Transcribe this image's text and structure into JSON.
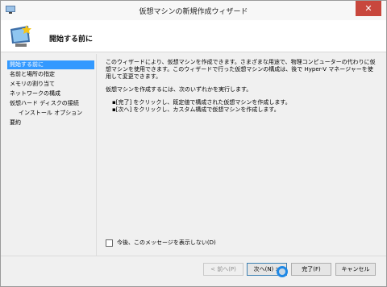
{
  "window": {
    "title": "仮想マシンの新規作成ウィザード",
    "close_label": "✕"
  },
  "header": {
    "heading": "開始する前に"
  },
  "nav": {
    "items": [
      {
        "label": "開始する前に",
        "active": true
      },
      {
        "label": "名前と場所の指定",
        "active": false
      },
      {
        "label": "メモリの割り当て",
        "active": false
      },
      {
        "label": "ネットワークの構成",
        "active": false
      },
      {
        "label": "仮想ハード ディスクの接続",
        "active": false
      },
      {
        "label": "インストール オプション",
        "active": false
      },
      {
        "label": "要約",
        "active": false
      }
    ]
  },
  "content": {
    "paragraph1": "このウィザードにより、仮想マシンを作成できます。さまざまな用途で、物理コンピューターの代わりに仮想マシンを使用できます。このウィザードで行った仮想マシンの構成は、後で Hyper-V マネージャーを使用して変更できます。",
    "paragraph2": "仮想マシンを作成するには、次のいずれかを実行します。",
    "bullet1": "▪[完了] をクリックし、既定値で構成された仮想マシンを作成します。",
    "bullet2": "▪[次へ] をクリックし、カスタム構成で仮想マシンを作成します。"
  },
  "checkbox": {
    "label": "今後、このメッセージを表示しない(D)",
    "checked": false
  },
  "buttons": {
    "back": "< 前へ(P)",
    "next": "次へ(N) >",
    "finish": "完了(F)",
    "cancel": "キャンセル"
  }
}
